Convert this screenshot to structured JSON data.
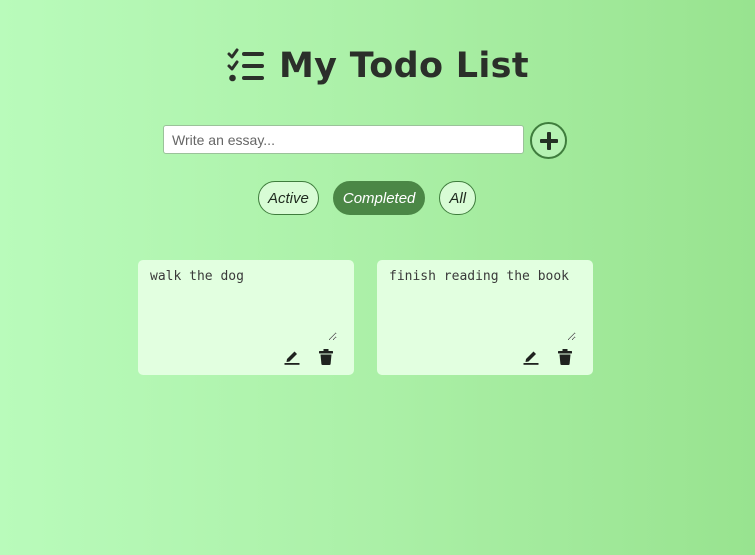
{
  "header": {
    "title": "My Todo List",
    "icon": "checklist-icon"
  },
  "add_form": {
    "input_value": "",
    "input_placeholder": "Write an essay...",
    "add_icon": "plus-circle-icon"
  },
  "filters": {
    "items": [
      {
        "label": "Active",
        "selected": false
      },
      {
        "label": "Completed",
        "selected": true
      },
      {
        "label": "All",
        "selected": false
      }
    ]
  },
  "todos": [
    {
      "text": "walk the dog",
      "edit_icon": "pencil-icon",
      "delete_icon": "trash-icon"
    },
    {
      "text": "finish reading the book",
      "edit_icon": "pencil-icon",
      "delete_icon": "trash-icon"
    }
  ],
  "colors": {
    "background_start": "#b9fbbb",
    "background_end": "#98e38f",
    "accent": "#4b8746",
    "card": "#e2ffe0",
    "title_text": "#2b2f2a"
  }
}
